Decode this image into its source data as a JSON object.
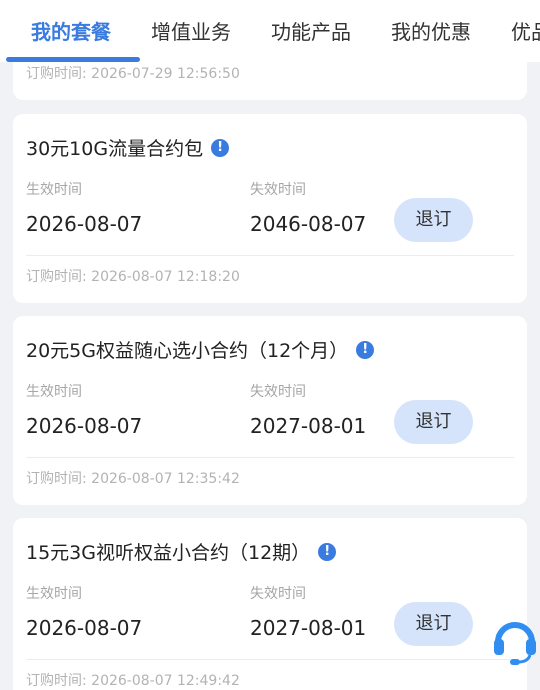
{
  "tabs": [
    {
      "label": "我的套餐",
      "active": true
    },
    {
      "label": "增值业务",
      "active": false
    },
    {
      "label": "功能产品",
      "active": false
    },
    {
      "label": "我的优惠",
      "active": false
    },
    {
      "label": "优品",
      "active": false
    }
  ],
  "colors": {
    "accent": "#3a7be0",
    "button_bg": "#d5e4fb",
    "page_bg": "#f1f2f5"
  },
  "partial_card": {
    "order_time": "订购时间: 2026-07-29 12:56:50"
  },
  "packages": [
    {
      "name": "30元10G流量合约包",
      "effective_label": "生效时间",
      "effective_date": "2026-08-07",
      "expiry_label": "失效时间",
      "expiry_date": "2046-08-07",
      "button_label": "退订",
      "order_time": "订购时间: 2026-08-07 12:18:20",
      "info_icon": "!"
    },
    {
      "name": "20元5G权益随心选小合约（12个月）",
      "effective_label": "生效时间",
      "effective_date": "2026-08-07",
      "expiry_label": "失效时间",
      "expiry_date": "2027-08-01",
      "button_label": "退订",
      "order_time": "订购时间: 2026-08-07 12:35:42",
      "info_icon": "!"
    },
    {
      "name": "15元3G视听权益小合约（12期）",
      "effective_label": "生效时间",
      "effective_date": "2026-08-07",
      "expiry_label": "失效时间",
      "expiry_date": "2027-08-01",
      "button_label": "退订",
      "order_time": "订购时间: 2026-08-07 12:49:42",
      "info_icon": "!"
    }
  ],
  "service_fab": {
    "icon": "headset-icon"
  }
}
